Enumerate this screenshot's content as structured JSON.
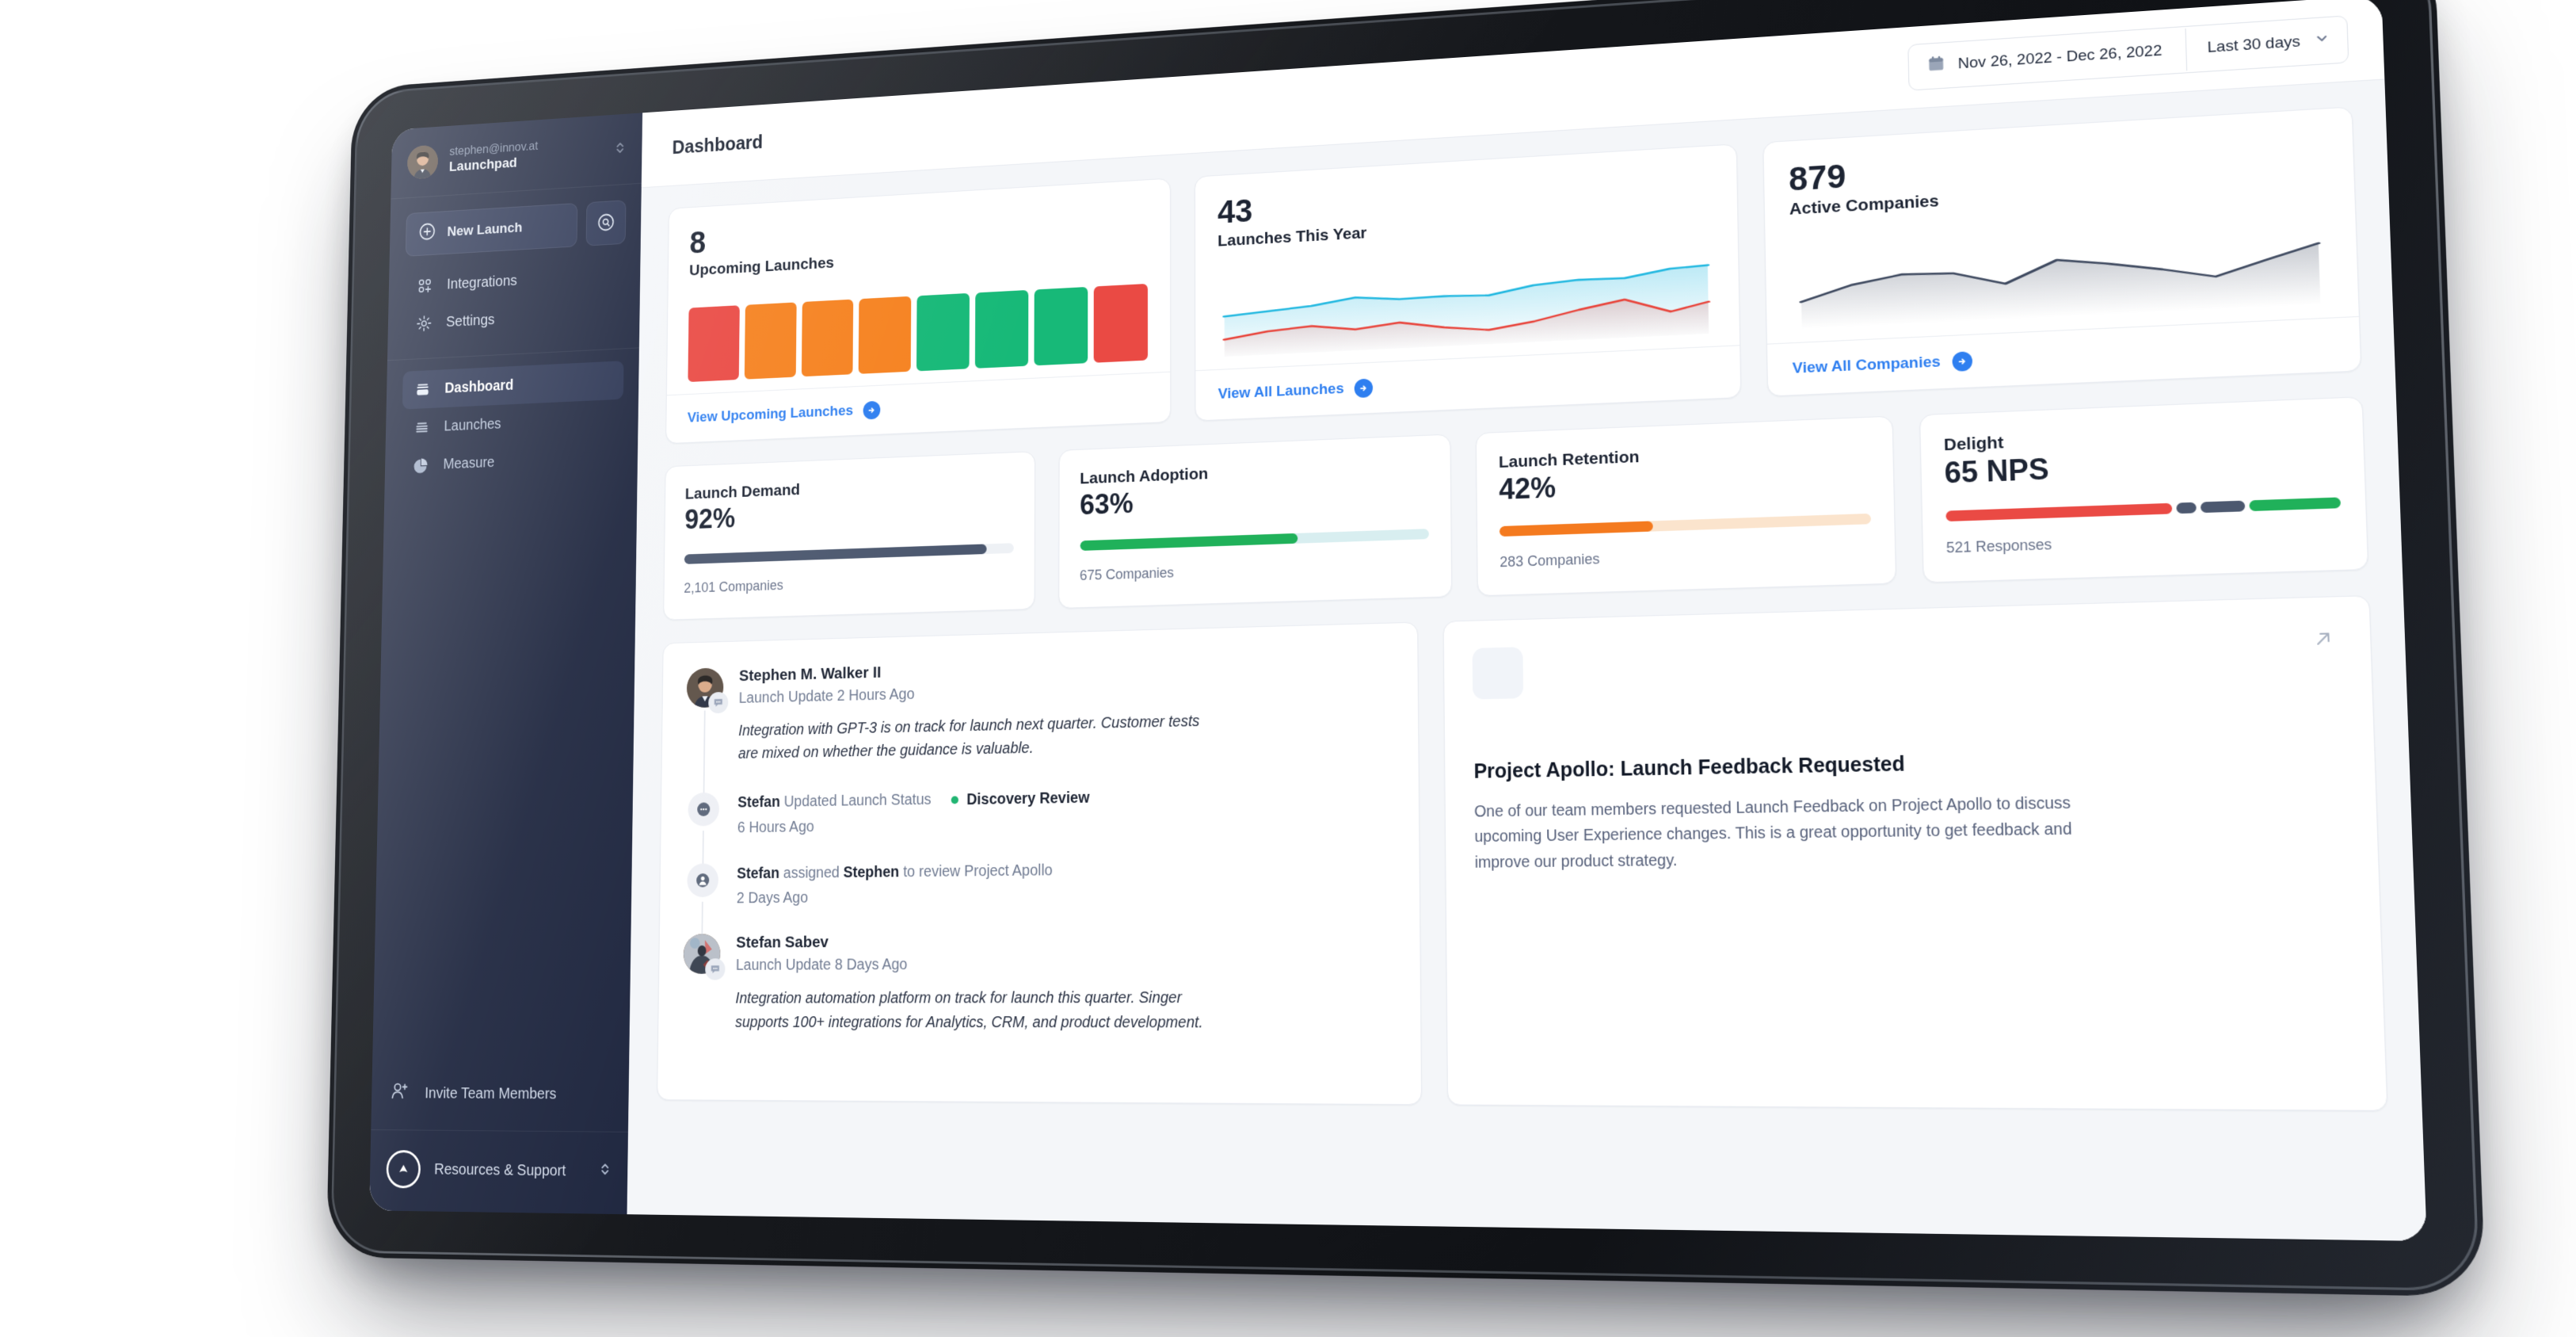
{
  "sidebar": {
    "account_email": "stephen@innov.at",
    "org_name": "Launchpad",
    "new_launch_label": "New Launch",
    "search_icon": "search-icon",
    "plus_icon": "plus-circle-icon",
    "switcher_icon": "chevron-up-down-icon",
    "primary_items": [
      {
        "label": "Integrations",
        "icon": "integrations-icon"
      },
      {
        "label": "Settings",
        "icon": "gear-icon"
      }
    ],
    "nav_items": [
      {
        "label": "Dashboard",
        "icon": "dashboard-icon",
        "active": true
      },
      {
        "label": "Launches",
        "icon": "launches-icon",
        "active": false
      },
      {
        "label": "Measure",
        "icon": "pie-chart-icon",
        "active": false
      }
    ],
    "invite_label": "Invite Team Members",
    "invite_icon": "user-plus-icon",
    "support_label": "Resources & Support",
    "support_icon": "launchpad-logo-icon",
    "support_chevron": "chevron-up-down-icon"
  },
  "topbar": {
    "title": "Dashboard",
    "date_range": "Nov 26, 2022 - Dec 26, 2022",
    "calendar_icon": "calendar-icon",
    "range_select": "Last 30 days",
    "select_chevron": "chevron-down-icon"
  },
  "stat_cards": [
    {
      "value": "8",
      "label": "Upcoming Launches",
      "link": "View Upcoming Launches",
      "link_icon": "arrow-right-circle-icon"
    },
    {
      "value": "43",
      "label": "Launches This Year",
      "link": "View All Launches",
      "link_icon": "arrow-right-circle-icon"
    },
    {
      "value": "879",
      "label": "Active Companies",
      "link": "View All Companies",
      "link_icon": "arrow-right-circle-icon"
    }
  ],
  "metrics": [
    {
      "title": "Launch Demand",
      "value": "92%",
      "sub": "2,101 Companies",
      "percent": 92,
      "color": "#4c586f",
      "track": "#eef1f5"
    },
    {
      "title": "Launch Adoption",
      "value": "63%",
      "sub": "675 Companies",
      "percent": 63,
      "color": "#20b15a",
      "track": "#d8eef0"
    },
    {
      "title": "Launch Retention",
      "value": "42%",
      "sub": "283 Companies",
      "percent": 42,
      "color": "#f47a1f",
      "track": "#fbe4cd"
    },
    {
      "title": "Delight",
      "value": "65 NPS",
      "sub": "521 Responses",
      "percent": 65,
      "nps": true
    }
  ],
  "feed": [
    {
      "kind": "update",
      "avatar": "stephen-avatar",
      "badge_icon": "comment-icon",
      "name": "Stephen M. Walker II",
      "meta": "Launch Update 2 Hours Ago",
      "quote": "Integration with GPT-3 is on track for launch next quarter. Customer tests are mixed on whether the guidance is valuable."
    },
    {
      "kind": "status",
      "icon": "comment-icon",
      "actor": "Stefan",
      "action": "Updated Launch Status",
      "status": "Discovery Review",
      "meta": "6 Hours Ago"
    },
    {
      "kind": "assign",
      "icon": "user-icon",
      "actor": "Stefan",
      "action_pre": "assigned",
      "target": "Stephen",
      "action_post": "to review Project Apollo",
      "meta": "2 Days Ago"
    },
    {
      "kind": "update",
      "avatar": "stefan-avatar",
      "badge_icon": "comment-icon",
      "name": "Stefan Sabev",
      "meta": "Launch Update 8 Days Ago",
      "quote": "Integration automation platform on track for launch this quarter. Singer supports 100+ integrations for Analytics, CRM, and product development."
    }
  ],
  "apollo": {
    "icon": "users-icon",
    "expand_icon": "arrow-up-right-icon",
    "title": "Project Apollo: Launch Feedback Requested",
    "body": "One of our team members requested Launch Feedback on Project Apollo to discuss upcoming User Experience changes. This is a great opportunity to get feedback and improve our product strategy."
  },
  "colors": {
    "sidebar_bg": "#1b233c",
    "accent_blue": "#2f7ff0",
    "green": "#20b15a",
    "orange": "#f47a1f",
    "red": "#ea4a44",
    "slate": "#4c586f"
  },
  "chart_data": [
    {
      "type": "bar",
      "title": "Upcoming Launches",
      "categories": [
        "1",
        "2",
        "3",
        "4",
        "5",
        "6",
        "7",
        "8"
      ],
      "values": [
        100,
        100,
        100,
        100,
        100,
        100,
        100,
        100
      ],
      "bar_colors": [
        "#ea4a44",
        "#f68220",
        "#f68220",
        "#f68220",
        "#17b978",
        "#17b978",
        "#17b978",
        "#ea4a44"
      ],
      "xlabel": "",
      "ylabel": "",
      "grid": false,
      "legend": false
    },
    {
      "type": "area",
      "title": "Launches This Year",
      "x": [
        0,
        1,
        2,
        3,
        4,
        5,
        6,
        7,
        8,
        9,
        10,
        11
      ],
      "series": [
        {
          "name": "launches",
          "color": "#22b8e0",
          "values": [
            52,
            56,
            60,
            68,
            63,
            64,
            62,
            72,
            76,
            75,
            84,
            86
          ]
        },
        {
          "name": "baseline",
          "color": "#e8453c",
          "values": [
            22,
            30,
            34,
            27,
            33,
            24,
            18,
            26,
            38,
            48,
            30,
            40
          ]
        }
      ],
      "grid": false,
      "legend": false
    },
    {
      "type": "area",
      "title": "Active Companies",
      "x": [
        0,
        1,
        2,
        3,
        4,
        5,
        6,
        7,
        8,
        9,
        10
      ],
      "series": [
        {
          "name": "companies",
          "color": "#3f4a60",
          "values": [
            34,
            52,
            62,
            60,
            44,
            70,
            62,
            52,
            40,
            58,
            74
          ]
        }
      ],
      "grid": false,
      "legend": false
    }
  ]
}
